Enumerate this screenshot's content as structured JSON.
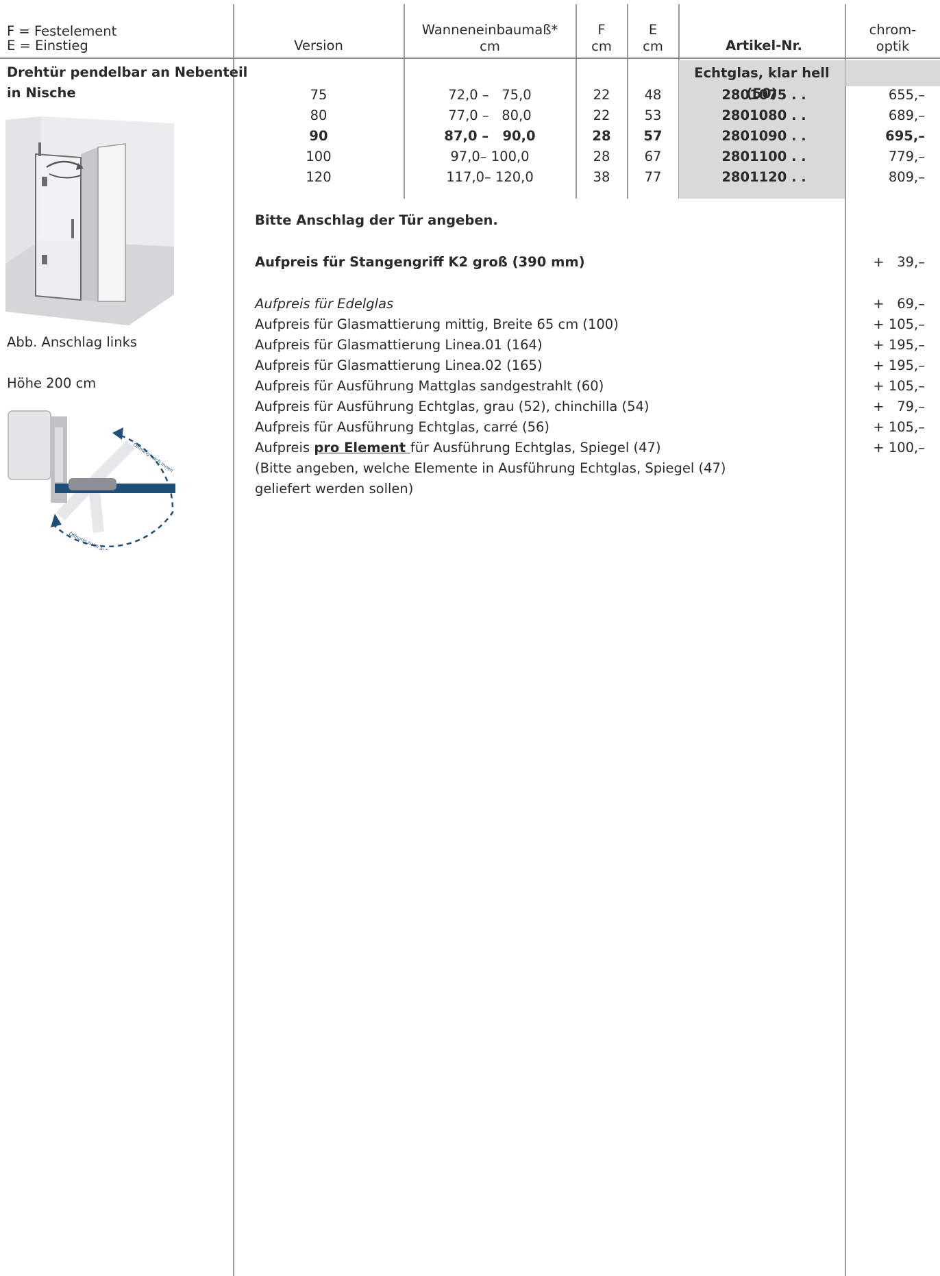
{
  "legend": {
    "line1": "F = Festelement",
    "line2": "E = Einstieg"
  },
  "headers": {
    "version": "Version",
    "wanne_line1": "Wanneneinbaumaß*",
    "wanne_line2": "cm",
    "f_line1": "F",
    "f_line2": "cm",
    "e_line1": "E",
    "e_line2": "cm",
    "artikel": "Artikel-Nr.",
    "chrom_line1": "chrom-",
    "chrom_line2": "optik"
  },
  "product": {
    "title_line1": "Drehtür pendelbar an Nebenteil",
    "title_line2": "in Nische",
    "caption": "Abb. Anschlag links",
    "height": "Höhe 200 cm",
    "hinge_label_inner": "Öffnung nach innen",
    "hinge_label_outer": "Öffnung nach außen"
  },
  "glass_header": "Echtglas, klar hell (50)",
  "rows": [
    {
      "version": "75",
      "wanne": "72,0 –   75,0",
      "f": "22",
      "e": "48",
      "artikel": "2801075 . .",
      "price": "655,–",
      "bold": false
    },
    {
      "version": "80",
      "wanne": "77,0 –   80,0",
      "f": "22",
      "e": "53",
      "artikel": "2801080 . .",
      "price": "689,–",
      "bold": false
    },
    {
      "version": "90",
      "wanne": "87,0 –   90,0",
      "f": "28",
      "e": "57",
      "artikel": "2801090 . .",
      "price": "695,–",
      "bold": true
    },
    {
      "version": "100",
      "wanne": "97,0– 100,0",
      "f": "28",
      "e": "67",
      "artikel": "2801100 . .",
      "price": "779,–",
      "bold": false
    },
    {
      "version": "120",
      "wanne": "117,0– 120,0",
      "f": "38",
      "e": "77",
      "artikel": "2801120 . .",
      "price": "809,–",
      "bold": false
    }
  ],
  "notes": {
    "anschlag": "Bitte Anschlag der Tür angeben.",
    "stangengriff": "Aufpreis für Stangengriff K2 groß (390 mm)",
    "stangengriff_price": "+   39,–"
  },
  "surcharges": [
    {
      "text": "Aufpreis für Edelglas",
      "price": "+   69,–"
    },
    {
      "text": "Aufpreis für Glasmattierung mittig, Breite 65 cm (100)",
      "price": "+ 105,–"
    },
    {
      "text": "Aufpreis für Glasmattierung Linea.01 (164)",
      "price": "+ 195,–"
    },
    {
      "text": "Aufpreis für Glasmattierung Linea.02 (165)",
      "price": "+ 195,–"
    },
    {
      "text": "Aufpreis für Ausführung Mattglas sandgestrahlt (60)",
      "price": "+ 105,–"
    },
    {
      "text": "Aufpreis für Ausführung Echtglas, grau (52), chinchilla (54)",
      "price": "+   79,–"
    },
    {
      "text": "Aufpreis für Ausführung Echtglas, carré (56)",
      "price": "+ 105,–"
    }
  ],
  "spiegel": {
    "prefix": "Aufpreis ",
    "emph": "pro Element ",
    "suffix": "für Ausführung Echtglas, Spiegel (47)",
    "price": "+ 100,–",
    "note_line1": "(Bitte angeben, welche Elemente in Ausführung Echtglas, Spiegel (47)",
    "note_line2": "geliefert werden sollen)"
  }
}
